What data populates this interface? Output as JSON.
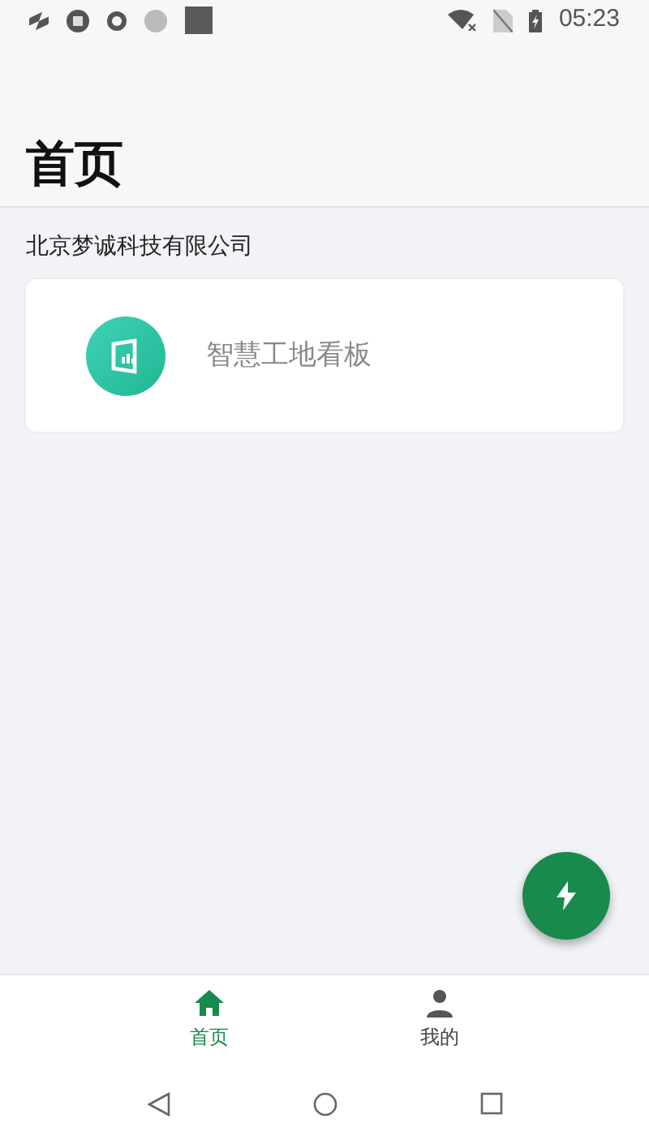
{
  "status_bar": {
    "time": "05:23"
  },
  "header": {
    "title": "首页"
  },
  "company": "北京梦诚科技有限公司",
  "apps": [
    {
      "label": "智慧工地看板"
    }
  ],
  "bottom_nav": [
    {
      "label": "首页",
      "kind": "home",
      "selected": true
    },
    {
      "label": "我的",
      "kind": "profile",
      "selected": false
    }
  ]
}
